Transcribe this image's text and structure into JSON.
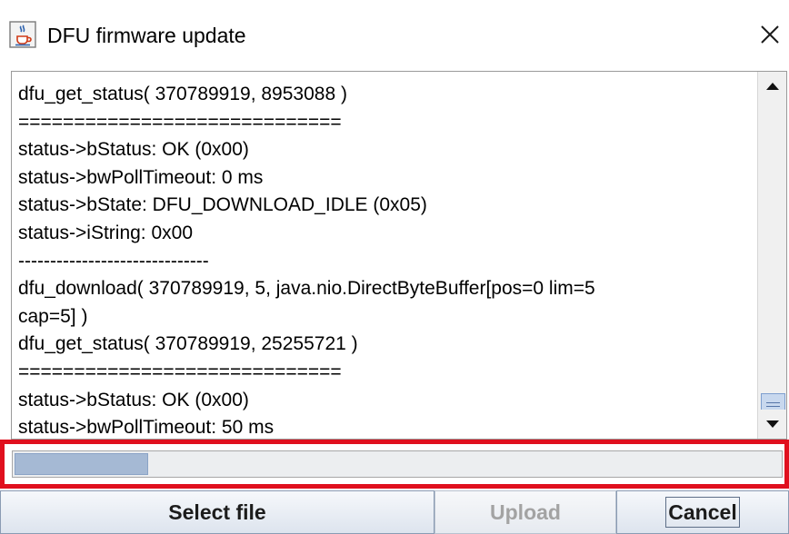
{
  "window": {
    "title": "DFU firmware update",
    "app_icon": "java-cup-icon",
    "close_glyph": "✕"
  },
  "log": {
    "lines": [
      "dfu_get_status( 370789919, 8953088 )",
      "=============================",
      "status->bStatus: OK (0x00)",
      "status->bwPollTimeout: 0 ms",
      "status->bState: DFU_DOWNLOAD_IDLE (0x05)",
      "status->iString: 0x00",
      "------------------------------",
      "dfu_download( 370789919, 5, java.nio.DirectByteBuffer[pos=0 lim=5",
      "cap=5] )",
      "dfu_get_status( 370789919, 25255721 )",
      "=============================",
      "status->bStatus: OK (0x00)",
      "status->bwPollTimeout: 50 ms"
    ]
  },
  "progress": {
    "fraction": 0.175
  },
  "buttons": {
    "select_file": "Select file",
    "upload": "Upload",
    "cancel": "Cancel"
  },
  "colors": {
    "highlight": "#e0101e",
    "progress_fill": "#a5b9d4",
    "scroll_thumb": "#c8d8ee"
  }
}
